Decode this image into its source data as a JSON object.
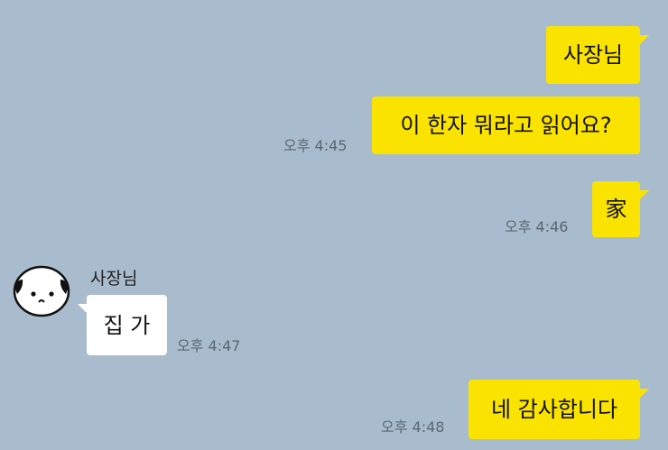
{
  "messages": [
    {
      "sender": "me",
      "text": "사장님"
    },
    {
      "sender": "me",
      "text": "이 한자 뭐라고 읽어요?",
      "time": "오후 4:45"
    },
    {
      "sender": "me",
      "text": "家",
      "time": "오후 4:46"
    },
    {
      "sender": "other",
      "name": "사장님",
      "text": "집 가",
      "time": "오후 4:47"
    },
    {
      "sender": "me",
      "text": "네 감사합니다",
      "time": "오후 4:48"
    }
  ],
  "colors": {
    "background": "#a9bccd",
    "my_bubble": "#fbe300",
    "their_bubble": "#ffffff",
    "timestamp": "#5b6670"
  },
  "icons": {
    "avatar": "sad-face-avatar-icon"
  }
}
